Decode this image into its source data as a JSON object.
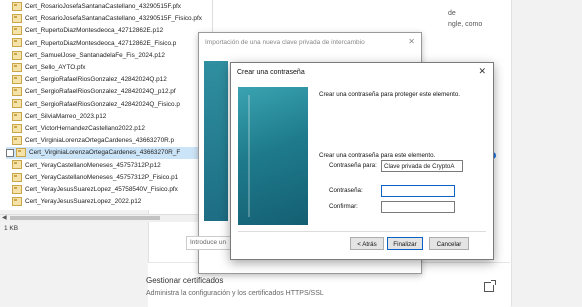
{
  "background": {
    "side_text": [
      "de",
      "ngle, como"
    ],
    "introduce_text": "Introduce un",
    "manage_certificates": {
      "title": "Gestionar certificados",
      "subtitle": "Administra la configuración y los certificados HTTPS/SSL"
    }
  },
  "file_list": {
    "items": [
      "Cert_RosarioJosefaSantanaCastellano_43290515F.pfx",
      "Cert_RosarioJosefaSantanaCastellano_43290515F_Fisico.pfx",
      "Cert_RupertoDiazMontesdeoca_42712862E.p12",
      "Cert_RupertoDiazMontesdeoca_42712862E_Fisico.p",
      "Cert_SamuelJose_SantanadelaFe_Fis_2024.p12",
      "Cert_Sello_AYTO.pfx",
      "Cert_SergioRafaelRiosGonzalez_42842024Q.p12",
      "Cert_SergioRafaelRiosGonzalez_42842024Q_p12.pf",
      "Cert_SergioRafaelRiosGonzalez_42842024Q_Fisico.p",
      "Cert_SilviaMarreo_2023.p12",
      "Cert_VictorHernandezCastellano2022.p12",
      "Cert_VirginiaLorenzaOrtegaCardenes_43663270R.p",
      "Cert_VirginiaLorenzaOrtegaCardenes_43663270R_F",
      "Cert_YerayCastellanoMeneses_45757312P.p12",
      "Cert_YerayCastellanoMeneses_45757312P_Fisico.p1",
      "Cert_YerayJesusSuarezLopez_45758540V_Fisico.pfx",
      "Cert_YerayJesusSuarezLopez_2022.p12"
    ],
    "selected_index": 12,
    "size_label": "1 KB"
  },
  "import_dialog": {
    "title": "Importación de una nueva clave privada de intercambio",
    "close": "✕"
  },
  "password_dialog": {
    "title": "Crear una contraseña",
    "close": "✕",
    "message1": "Crear una contraseña para proteger este elemento.",
    "message2": "Crear una contraseña para este elemento.",
    "label_for": "Contraseña para:",
    "value_for": "Clave privada de CryptoA",
    "label_password": "Contraseña:",
    "label_confirm": "Confirmar:",
    "password_value": "",
    "confirm_value": "",
    "buttons": {
      "back": "< Atrás",
      "finish": "Finalizar",
      "cancel": "Cancelar"
    }
  }
}
